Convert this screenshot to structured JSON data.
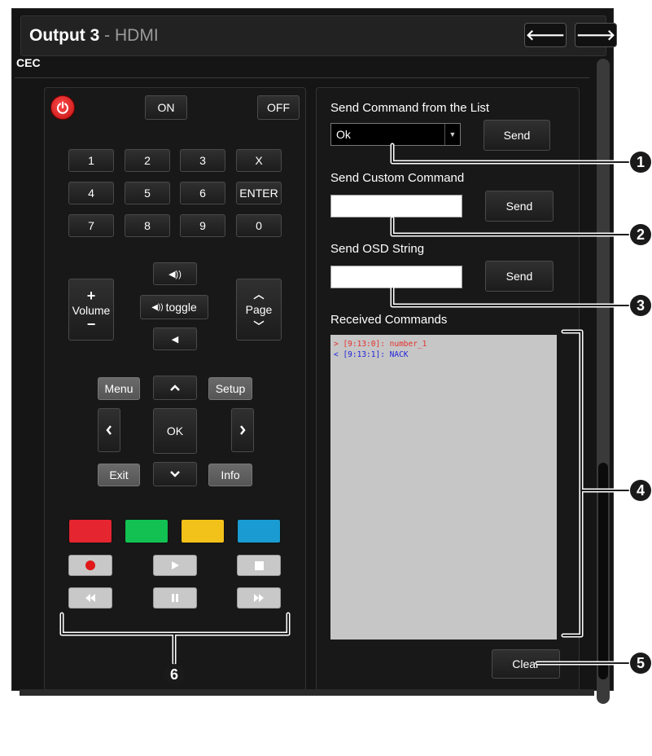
{
  "header": {
    "title": "Output 3",
    "subtitle": "- HDMI",
    "back_icon": "arrow-left-icon",
    "forward_icon": "arrow-right-icon"
  },
  "section": {
    "title": "CEC"
  },
  "remote": {
    "on_label": "ON",
    "off_label": "OFF",
    "keypad": [
      "1",
      "2",
      "3",
      "X",
      "4",
      "5",
      "6",
      "ENTER",
      "7",
      "8",
      "9",
      "0"
    ],
    "volume_label": "Volume",
    "volume_plus": "+",
    "volume_minus": "−",
    "mute_toggle_label": "toggle",
    "page_label": "Page",
    "menu_label": "Menu",
    "setup_label": "Setup",
    "ok_label": "OK",
    "exit_label": "Exit",
    "info_label": "Info",
    "color_keys": [
      "#e5252f",
      "#12c152",
      "#f2c11a",
      "#1a9bd1"
    ]
  },
  "commands": {
    "list_label": "Send Command from the List",
    "list_selected": "Ok",
    "send_label": "Send",
    "custom_label": "Send Custom Command",
    "custom_value": "",
    "osd_label": "Send OSD String",
    "osd_value": "",
    "received_label": "Received Commands",
    "received": [
      {
        "text": "> [9:13:0]: number_1",
        "dir": "out"
      },
      {
        "text": "< [9:13:1]: NACK",
        "dir": "in"
      }
    ],
    "clear_label": "Clear"
  },
  "callouts": [
    "1",
    "2",
    "3",
    "4",
    "5",
    "6"
  ]
}
